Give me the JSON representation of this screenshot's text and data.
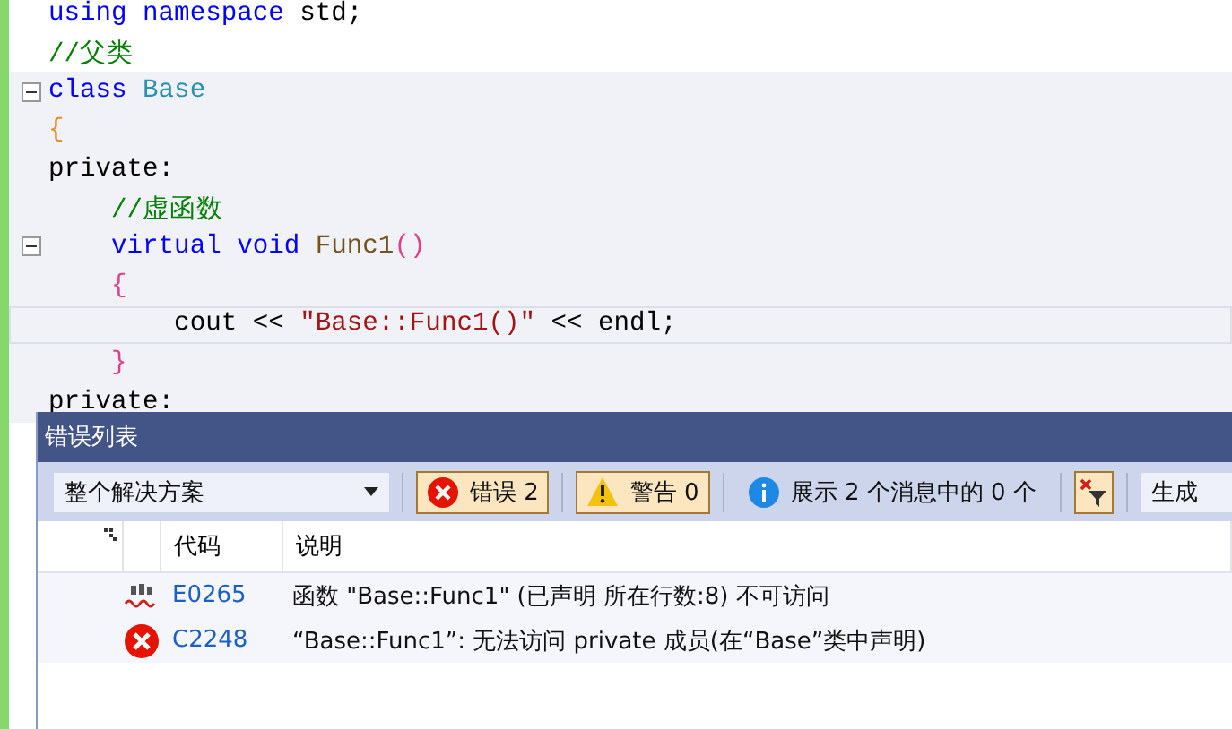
{
  "code_lines": [
    {
      "collapsible": false,
      "in_scope": false,
      "current": false,
      "tokens": [
        {
          "text": "using ",
          "kind": "keyword"
        },
        {
          "text": "namespace ",
          "kind": "keyword"
        },
        {
          "text": "std;",
          "kind": "plain"
        }
      ]
    },
    {
      "collapsible": false,
      "in_scope": false,
      "current": false,
      "tokens": [
        {
          "text": "//父类",
          "kind": "comment"
        }
      ]
    },
    {
      "collapsible": true,
      "in_scope": true,
      "current": false,
      "tokens": [
        {
          "text": "class ",
          "kind": "keyword"
        },
        {
          "text": "Base",
          "kind": "type"
        }
      ]
    },
    {
      "collapsible": false,
      "in_scope": true,
      "current": false,
      "tokens": [
        {
          "text": "{",
          "kind": "brace1"
        }
      ]
    },
    {
      "collapsible": false,
      "in_scope": true,
      "current": false,
      "tokens": [
        {
          "text": "private:",
          "kind": "plain"
        }
      ]
    },
    {
      "collapsible": false,
      "in_scope": true,
      "current": false,
      "tokens": [
        {
          "text": "    //虚函数",
          "kind": "comment"
        }
      ]
    },
    {
      "collapsible": true,
      "in_scope": true,
      "current": false,
      "tokens": [
        {
          "text": "    virtual ",
          "kind": "keyword"
        },
        {
          "text": "void ",
          "kind": "keyword"
        },
        {
          "text": "Func1",
          "kind": "function"
        },
        {
          "text": "()",
          "kind": "brace2"
        }
      ]
    },
    {
      "collapsible": false,
      "in_scope": true,
      "current": false,
      "tokens": [
        {
          "text": "    {",
          "kind": "brace2"
        }
      ]
    },
    {
      "collapsible": false,
      "in_scope": true,
      "current": true,
      "tokens": [
        {
          "text": "        cout << ",
          "kind": "plain"
        },
        {
          "text": "\"Base::Func1()\"",
          "kind": "string"
        },
        {
          "text": " << endl;",
          "kind": "plain"
        }
      ]
    },
    {
      "collapsible": false,
      "in_scope": true,
      "current": false,
      "tokens": [
        {
          "text": "    }",
          "kind": "brace2"
        }
      ]
    },
    {
      "collapsible": false,
      "in_scope": true,
      "current": false,
      "tokens": [
        {
          "text": "private:",
          "kind": "plain"
        }
      ]
    }
  ],
  "error_list": {
    "title": "错误列表",
    "scope_dropdown": "整个解决方案",
    "filters": [
      {
        "kind": "error",
        "label": "错误 2",
        "selected": true
      },
      {
        "kind": "warning",
        "label": "警告 0",
        "selected": true
      },
      {
        "kind": "info",
        "label": "展示 2 个消息中的 0 个",
        "selected": false
      }
    ],
    "build_dropdown": "生成",
    "columns": [
      "代码",
      "说明"
    ],
    "rows": [
      {
        "kind": "spelling",
        "code": "E0265",
        "description": "函数 \"Base::Func1\" (已声明 所在行数:8) 不可访问"
      },
      {
        "kind": "error",
        "code": "C2248",
        "description": "“Base::Func1”: 无法访问 private 成员(在“Base”类中声明)"
      }
    ]
  }
}
